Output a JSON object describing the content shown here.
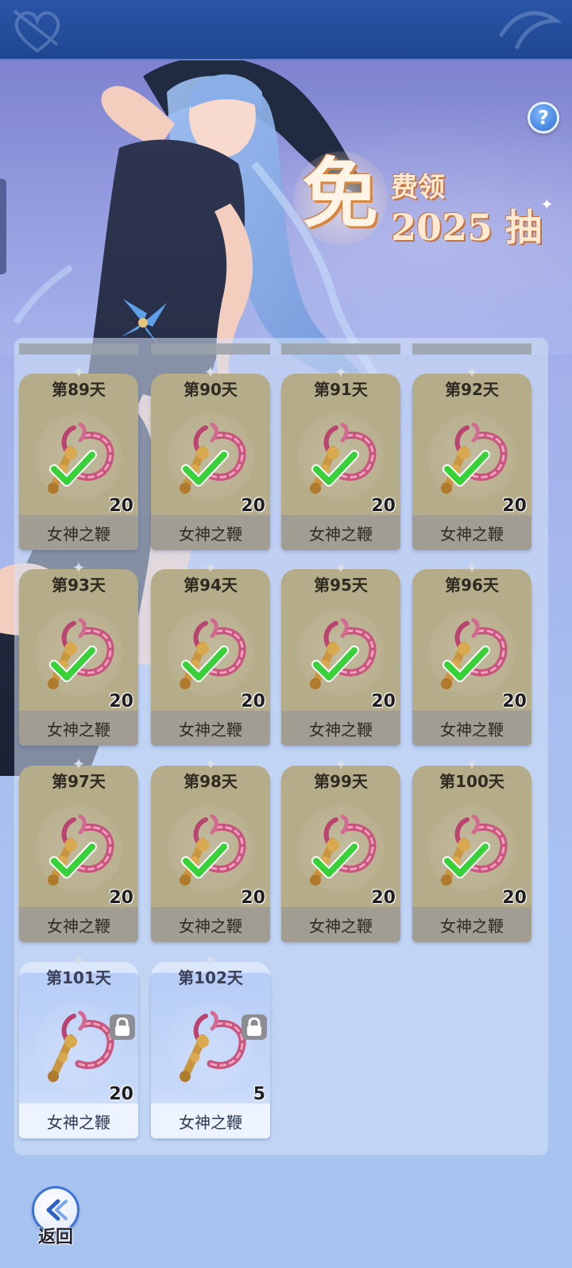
{
  "header": {},
  "promo": {
    "big_char": "免",
    "line1": "费领",
    "line2": "2025 抽"
  },
  "help": {
    "label": "?"
  },
  "colors": {
    "claimed_card": "#b5ac89",
    "locked_card": "#c7d9fa",
    "check_green": "#39d13a",
    "accent_blue": "#3b73d6"
  },
  "rewards": [
    {
      "day": "第89天",
      "item": "女神之鞭",
      "qty": "20",
      "status": "claimed"
    },
    {
      "day": "第90天",
      "item": "女神之鞭",
      "qty": "20",
      "status": "claimed"
    },
    {
      "day": "第91天",
      "item": "女神之鞭",
      "qty": "20",
      "status": "claimed"
    },
    {
      "day": "第92天",
      "item": "女神之鞭",
      "qty": "20",
      "status": "claimed"
    },
    {
      "day": "第93天",
      "item": "女神之鞭",
      "qty": "20",
      "status": "claimed"
    },
    {
      "day": "第94天",
      "item": "女神之鞭",
      "qty": "20",
      "status": "claimed"
    },
    {
      "day": "第95天",
      "item": "女神之鞭",
      "qty": "20",
      "status": "claimed"
    },
    {
      "day": "第96天",
      "item": "女神之鞭",
      "qty": "20",
      "status": "claimed"
    },
    {
      "day": "第97天",
      "item": "女神之鞭",
      "qty": "20",
      "status": "claimed"
    },
    {
      "day": "第98天",
      "item": "女神之鞭",
      "qty": "20",
      "status": "claimed"
    },
    {
      "day": "第99天",
      "item": "女神之鞭",
      "qty": "20",
      "status": "claimed"
    },
    {
      "day": "第100天",
      "item": "女神之鞭",
      "qty": "20",
      "status": "claimed"
    },
    {
      "day": "第101天",
      "item": "女神之鞭",
      "qty": "20",
      "status": "locked"
    },
    {
      "day": "第102天",
      "item": "女神之鞭",
      "qty": "5",
      "status": "locked"
    }
  ],
  "footer": {
    "back_label": "返回"
  }
}
